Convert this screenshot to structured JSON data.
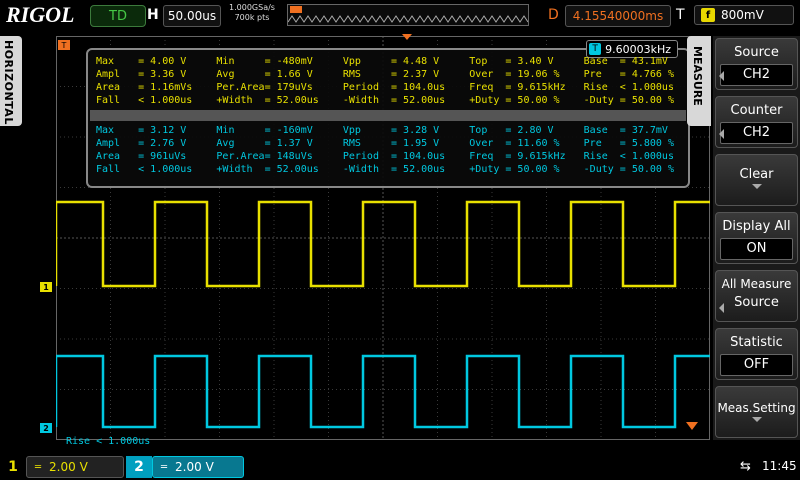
{
  "topbar": {
    "logo": "RIGOL",
    "run_state": "TD",
    "h_label": "H",
    "timebase": "50.00us",
    "sample_rate": "1.000GSa/s",
    "mem_depth": "700k pts",
    "d_label": "D",
    "delay": "4.15540000ms",
    "t_label": "T",
    "trigger_source_badge": "f",
    "trigger_level": "800mV"
  },
  "side_tab_left": "HORIZONTAL",
  "side_tab_right": "MEASURE",
  "markers": {
    "trigger": "T",
    "ch1": "1",
    "ch2": "2"
  },
  "measurement": {
    "freq_badge": "T",
    "freq_readout": "9.60003kHz",
    "ch1_rows": [
      "Max    = 4.00 V     Min     = -480mV     Vpp     = 4.48 V     Top   = 3.40 V     Base  = 43.1mV",
      "Ampl   = 3.36 V     Avg     = 1.66 V     RMS     = 2.37 V     Over  = 19.06 %    Pre   = 4.766 %",
      "Area   = 1.16mVs    Per.Area= 179uVs     Period  = 104.0us    Freq  = 9.615kHz   Rise  < 1.000us",
      "Fall   < 1.000us    +Width  = 52.00us    -Width  = 52.00us    +Duty = 50.00 %    -Duty = 50.00 %"
    ],
    "ch2_rows": [
      "Max    = 3.12 V     Min     = -160mV     Vpp     = 3.28 V     Top   = 2.80 V     Base  = 37.7mV",
      "Ampl   = 2.76 V     Avg     = 1.37 V     RMS     = 1.95 V     Over  = 11.60 %    Pre   = 5.800 %",
      "Area   = 961uVs     Per.Area= 148uVs     Period  = 104.0us    Freq  = 9.615kHz   Rise  < 1.000us",
      "Fall   < 1.000us    +Width  = 52.00us    -Width  = 52.00us    +Duty = 50.00 %    -Duty = 50.00 %"
    ]
  },
  "bottom_info": "Rise < 1.000us",
  "menu": {
    "source": {
      "label": "Source",
      "value": "CH2"
    },
    "counter": {
      "label": "Counter",
      "value": "CH2"
    },
    "clear": {
      "label": "Clear"
    },
    "display_all": {
      "label": "Display All",
      "value": "ON"
    },
    "all_measure_source": {
      "label1": "All Measure",
      "label2": "Source"
    },
    "statistic": {
      "label": "Statistic",
      "value": "OFF"
    },
    "meas_setting": {
      "label": "Meas.Setting"
    }
  },
  "channels": {
    "ch1": {
      "num": "1",
      "coupling": "═",
      "scale": "2.00 V",
      "color": "#e8e000"
    },
    "ch2": {
      "num": "2",
      "coupling": "═",
      "scale": "2.00 V",
      "color": "#00c8e0"
    }
  },
  "status": {
    "usb_icon": "⇆",
    "time": "11:45"
  }
}
